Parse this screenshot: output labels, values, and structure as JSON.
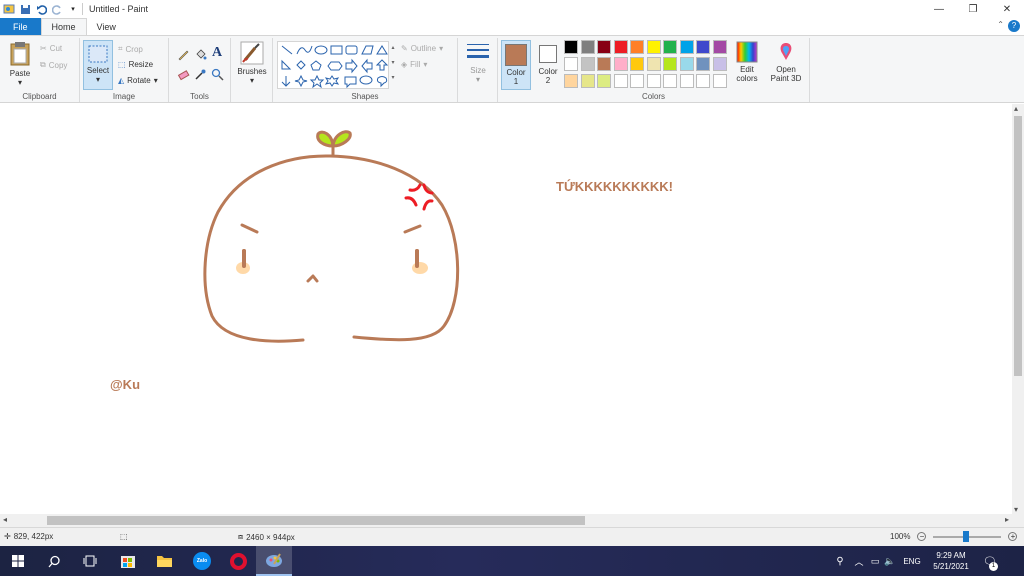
{
  "window": {
    "title": "Untitled - Paint",
    "controls": {
      "minimize": "—",
      "maximize": "❐",
      "close": "✕"
    }
  },
  "tabs": [
    {
      "label": "File"
    },
    {
      "label": "Home"
    },
    {
      "label": "View"
    }
  ],
  "ribbon": {
    "clipboard": {
      "paste": "Paste",
      "cut": "Cut",
      "copy": "Copy",
      "group_label": "Clipboard"
    },
    "image": {
      "select": "Select",
      "crop": "Crop",
      "resize": "Resize",
      "rotate": "Rotate",
      "group_label": "Image"
    },
    "tools": {
      "group_label": "Tools"
    },
    "brushes": {
      "label": "Brushes"
    },
    "shapes": {
      "outline": "Outline",
      "fill": "Fill",
      "group_label": "Shapes"
    },
    "size": {
      "label": "Size"
    },
    "colors": {
      "color1_label": "Color",
      "color1_num": "1",
      "color2_label": "Color",
      "color2_num": "2",
      "color1_value": "#b97a57",
      "color2_value": "#ffffff",
      "group_label": "Colors",
      "palette_row1": [
        "#000000",
        "#7f7f7f",
        "#880015",
        "#ed1c24",
        "#ff7f27",
        "#fff200",
        "#22b14c",
        "#00a2e8",
        "#3f48cc",
        "#a349a4"
      ],
      "palette_row2": [
        "#ffffff",
        "#c3c3c3",
        "#b97a57",
        "#ffaec9",
        "#ffc90e",
        "#efe4b0",
        "#b5e61d",
        "#99d9ea",
        "#7092be",
        "#c8bfe7"
      ],
      "palette_row3": [
        "#ffd59e",
        "#e6e68a",
        "#dcec82",
        "#ffffff",
        "#ffffff",
        "#ffffff",
        "#ffffff",
        "#ffffff",
        "#ffffff",
        "#ffffff"
      ],
      "edit_colors": "Edit colors",
      "open_paint3d": "Open Paint 3D"
    }
  },
  "canvas": {
    "text_shout": "TỨKKKKKKKKKK!",
    "text_signature": "@Ku",
    "stroke_color": "#b97a57"
  },
  "status": {
    "cursor_pos": "829, 422px",
    "image_size": "2460 × 944px",
    "zoom": "100%"
  },
  "taskbar": {
    "lang": "ENG",
    "time": "9:29 AM",
    "date": "5/21/2021",
    "notif_count": "1",
    "zalo_label": "Zalo"
  }
}
